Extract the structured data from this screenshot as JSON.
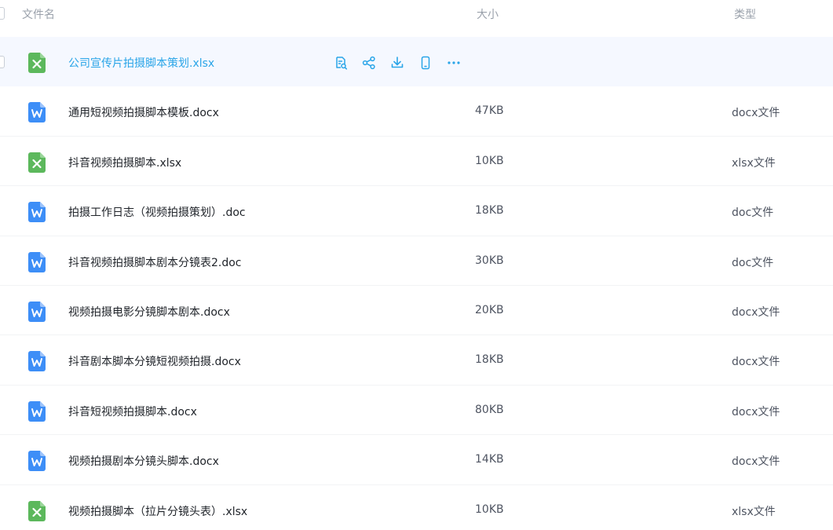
{
  "header": {
    "name_label": "文件名",
    "size_label": "大小",
    "type_label": "类型"
  },
  "files": [
    {
      "name": "公司宣传片拍摄脚本策划.xlsx",
      "size": "",
      "type": "",
      "icon": "excel-file-icon",
      "hover": true
    },
    {
      "name": "通用短视频拍摄脚本模板.docx",
      "size": "47KB",
      "type": "docx文件",
      "icon": "word-file-icon"
    },
    {
      "name": "抖音视频拍摄脚本.xlsx",
      "size": "10KB",
      "type": "xlsx文件",
      "icon": "excel-file-icon"
    },
    {
      "name": "拍摄工作日志（视频拍摄策划）.doc",
      "size": "18KB",
      "type": "doc文件",
      "icon": "word-file-icon"
    },
    {
      "name": "抖音视频拍摄脚本剧本分镜表2.doc",
      "size": "30KB",
      "type": "doc文件",
      "icon": "word-file-icon"
    },
    {
      "name": "视频拍摄电影分镜脚本剧本.docx",
      "size": "20KB",
      "type": "docx文件",
      "icon": "word-file-icon"
    },
    {
      "name": "抖音剧本脚本分镜短视频拍摄.docx",
      "size": "18KB",
      "type": "docx文件",
      "icon": "word-file-icon"
    },
    {
      "name": "抖音短视频拍摄脚本.docx",
      "size": "80KB",
      "type": "docx文件",
      "icon": "word-file-icon"
    },
    {
      "name": "视频拍摄剧本分镜头脚本.docx",
      "size": "14KB",
      "type": "docx文件",
      "icon": "word-file-icon"
    },
    {
      "name": "视频拍摄脚本（拉片分镜头表）.xlsx",
      "size": "10KB",
      "type": "xlsx文件",
      "icon": "excel-file-icon"
    }
  ],
  "row_actions": [
    "preview-icon",
    "share-icon",
    "download-icon",
    "phone-icon",
    "more-icon"
  ],
  "colors": {
    "excel": "#5cb85c",
    "word": "#3d8ef7",
    "hover_name": "#2aa5e8",
    "hover_bg": "#f5f8ff",
    "action_icon": "#2aa5e8"
  }
}
